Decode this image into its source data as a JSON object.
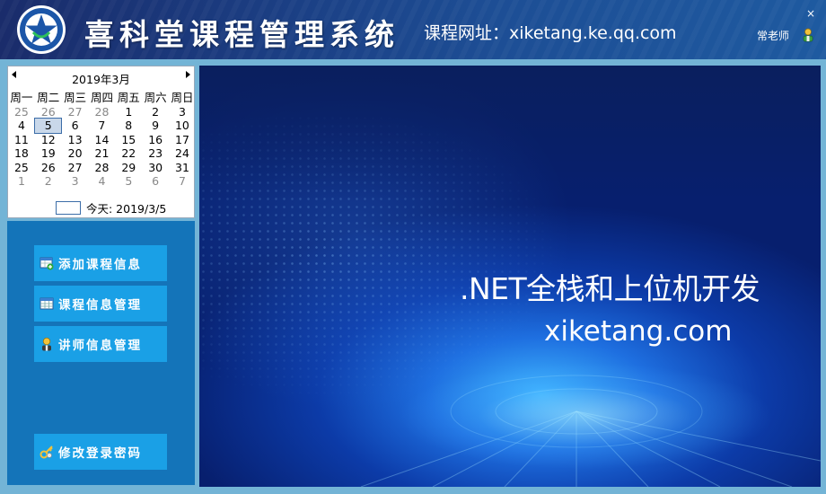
{
  "header": {
    "title": "喜科堂课程管理系统",
    "site": "课程网址：xiketang.ke.qq.com",
    "close": "×",
    "user": "常老师"
  },
  "calendar": {
    "month": "2019年3月",
    "weekdays": [
      "周一",
      "周二",
      "周三",
      "周四",
      "周五",
      "周六",
      "周日"
    ],
    "weeks": [
      [
        "25",
        "26",
        "27",
        "28",
        "1",
        "2",
        "3"
      ],
      [
        "4",
        "5",
        "6",
        "7",
        "8",
        "9",
        "10"
      ],
      [
        "11",
        "12",
        "13",
        "14",
        "15",
        "16",
        "17"
      ],
      [
        "18",
        "19",
        "20",
        "21",
        "22",
        "23",
        "24"
      ],
      [
        "25",
        "26",
        "27",
        "28",
        "29",
        "30",
        "31"
      ],
      [
        "1",
        "2",
        "3",
        "4",
        "5",
        "6",
        "7"
      ]
    ],
    "selected": "5",
    "today": "今天: 2019/3/5"
  },
  "sidebar": {
    "items": [
      {
        "label": "添加课程信息",
        "icon": "add-course-icon"
      },
      {
        "label": "课程信息管理",
        "icon": "table-icon"
      },
      {
        "label": "讲师信息管理",
        "icon": "teacher-icon"
      },
      {
        "label": "修改登录密码",
        "icon": "key-icon"
      }
    ]
  },
  "banner": {
    "line1": ".NET全栈和上位机开发",
    "line2": "xiketang.com"
  },
  "colors": {
    "header": "#1b3f84",
    "sidebar": "#1474b9",
    "button": "#1aa0e6",
    "background": "#73b4d6"
  }
}
